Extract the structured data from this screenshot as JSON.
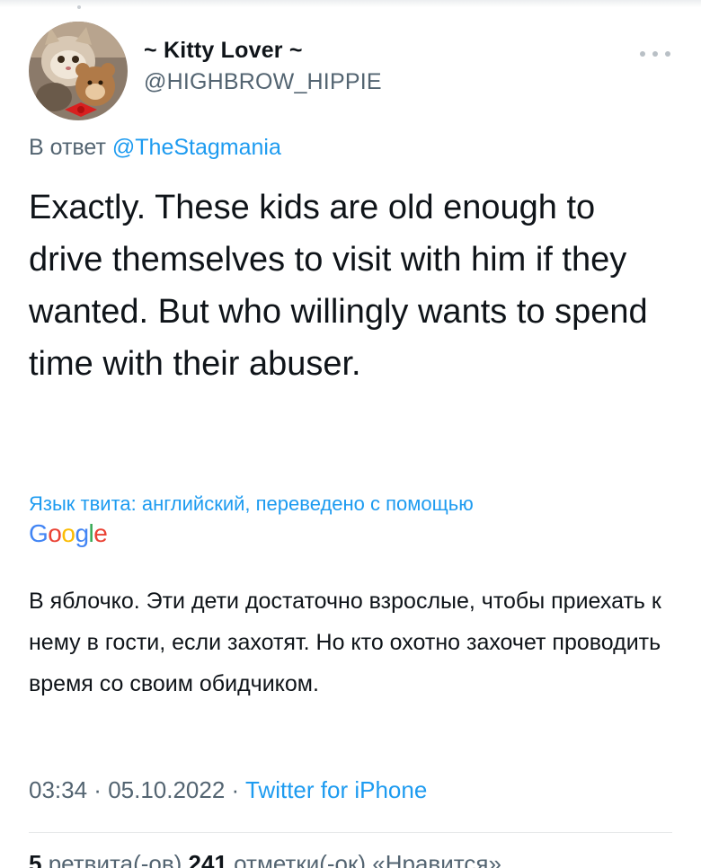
{
  "author": {
    "display_name": "~ Kitty Lover ~",
    "handle": "@HIGHBROW_HIPPIE"
  },
  "reply": {
    "prefix": "В ответ ",
    "mention": "@TheStagmania"
  },
  "tweet_text": "Exactly. These kids are old enough to drive themselves to visit with him if they wanted. But who willingly wants to spend time with their abuser.",
  "translation_notice": {
    "label": "Язык твита: английский, переведено с помощью",
    "provider": "Google",
    "provider_letter_colors": [
      "#4285F4",
      "#EA4335",
      "#FBBC05",
      "#4285F4",
      "#34A853",
      "#EA4335"
    ]
  },
  "translated_text": "В яблочко. Эти дети достаточно взрослые, чтобы приехать к нему в гости, если захотят. Но кто охотно захочет проводить время со своим обидчиком.",
  "meta": {
    "time": "03:34",
    "separator1": " · ",
    "date": "05.10.2022",
    "separator2": " · ",
    "source": "Twitter for iPhone"
  },
  "stats": {
    "retweets_count": "5",
    "retweets_label": " ретвита(-ов)  ",
    "likes_count": "241",
    "likes_label": " отметки(-ок) «Нравится»"
  },
  "colors": {
    "link": "#1d9bf0",
    "secondary_text": "#536471",
    "primary_text": "#0f1419"
  }
}
